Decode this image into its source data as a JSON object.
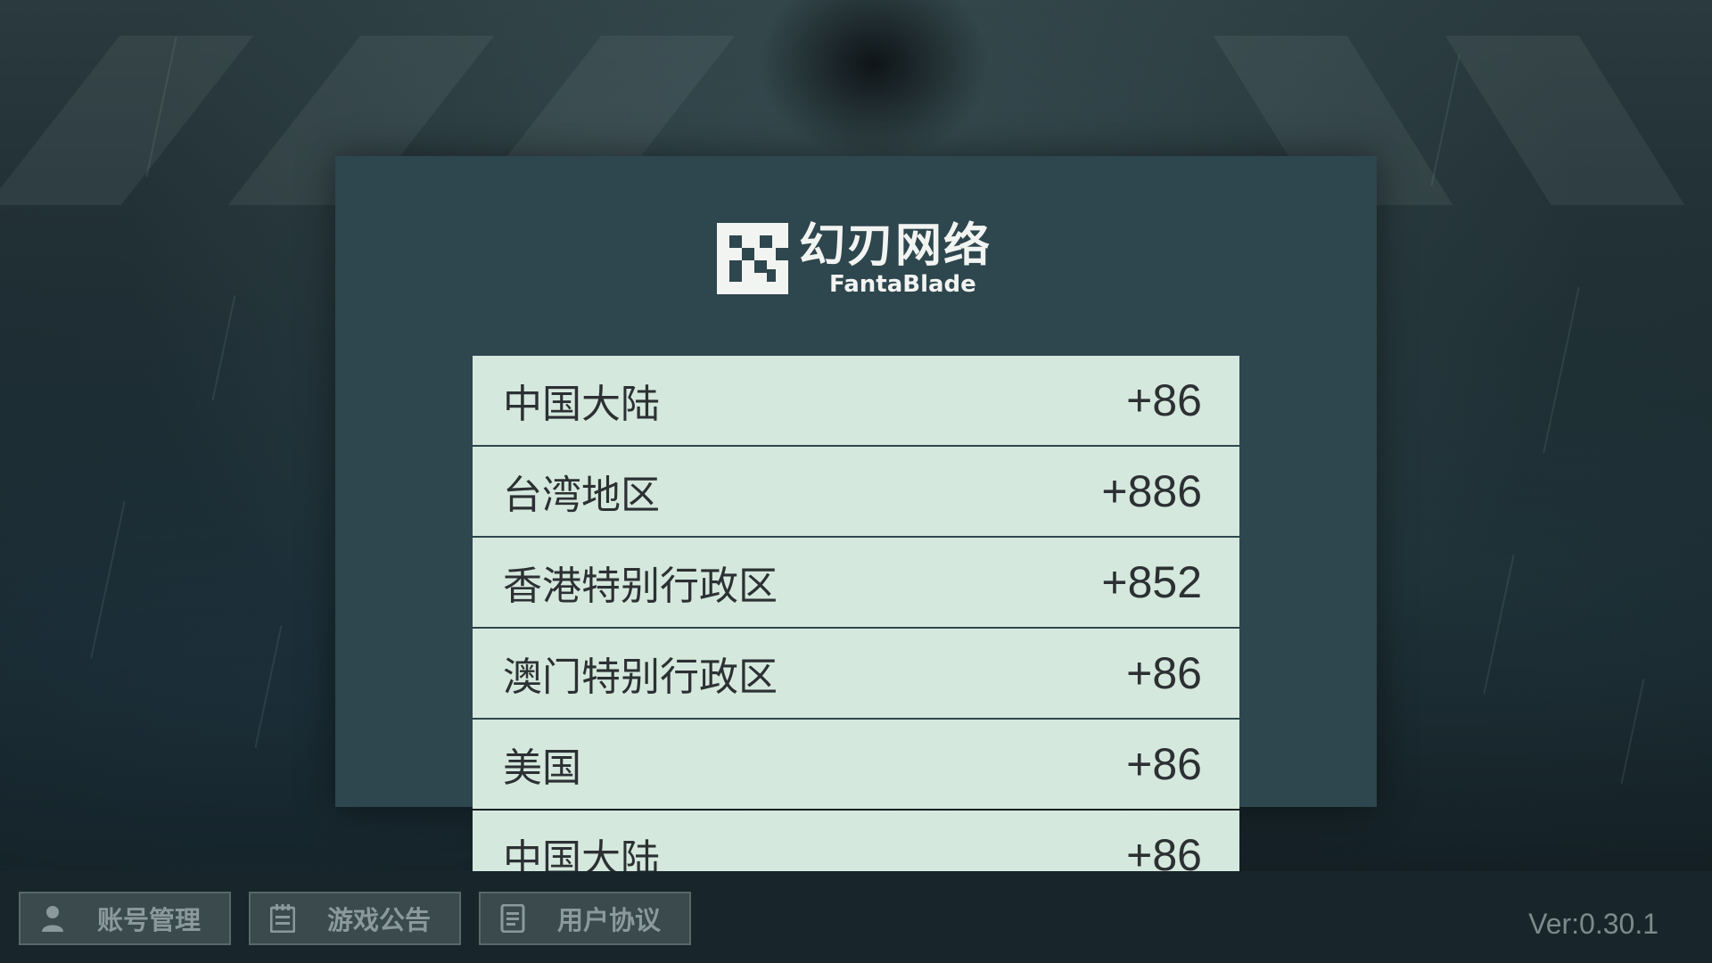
{
  "logo": {
    "cn_text": "幻刃网络",
    "en_text": "FantaBlade"
  },
  "region_list": [
    {
      "name": "中国大陆",
      "code": "+86"
    },
    {
      "name": "台湾地区",
      "code": "+886"
    },
    {
      "name": "香港特别行政区",
      "code": "+852"
    },
    {
      "name": "澳门特别行政区",
      "code": "+86"
    },
    {
      "name": "美国",
      "code": "+86"
    },
    {
      "name": "中国大陆",
      "code": "+86"
    }
  ],
  "bottom_bar": {
    "account_label": "账号管理",
    "notice_label": "游戏公告",
    "agreement_label": "用户协议",
    "version": "Ver:0.30.1"
  },
  "icons": {
    "account": "person-icon",
    "notice": "calendar-icon",
    "agreement": "document-icon"
  },
  "colors": {
    "panel_bg": "#2e464d",
    "row_bg": "#d5e8dd",
    "row_text": "#2c3033",
    "button_bg": "#3a4a4d",
    "button_text": "#8c999b"
  }
}
